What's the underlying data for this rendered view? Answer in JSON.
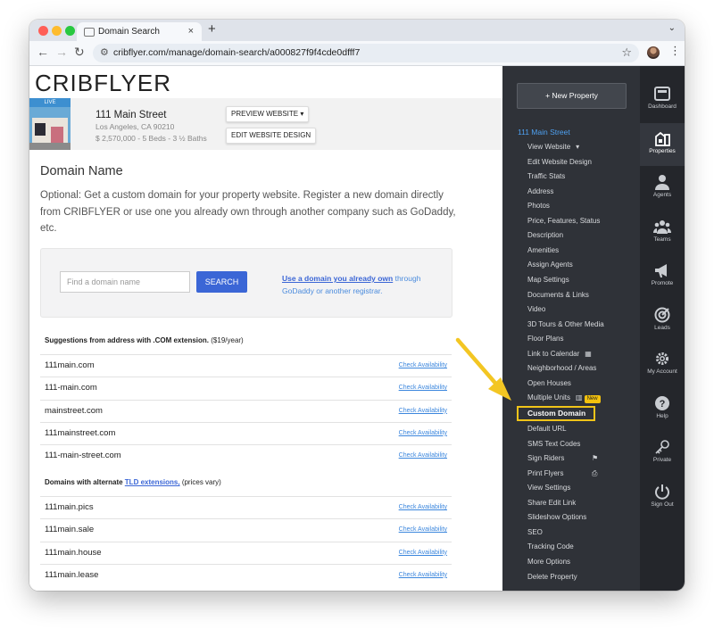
{
  "browser": {
    "tab_title": "Domain Search",
    "url": "cribflyer.com/manage/domain-search/a000827f9f4cde0dfff7",
    "new_tab": "+",
    "tab_close": "×"
  },
  "logo": "CRIBFLYER",
  "property": {
    "live_badge": "LIVE",
    "address": "111 Main Street",
    "city": "Los Angeles, CA 90210",
    "details": "$ 2,570,000 - 5 Beds - 3 ½ Baths",
    "preview_button": "PREVIEW WEBSITE ▾",
    "edit_button": "EDIT WEBSITE DESIGN"
  },
  "main": {
    "heading": "Domain Name",
    "intro": "Optional: Get a custom domain for your property website. Register a new domain directly from CRIBFLYER or use one you already own through another company such as GoDaddy, etc.",
    "search_placeholder": "Find a domain name",
    "search_button": "SEARCH",
    "own_link": "Use a domain you already own",
    "own_text": " through GoDaddy or another registrar.",
    "suggest_heading": "Suggestions from address with .COM extension.",
    "suggest_price": " ($19/year)",
    "com_domains": [
      "111main.com",
      "111-main.com",
      "mainstreet.com",
      "111mainstreet.com",
      "111-main-street.com"
    ],
    "alt_heading_pre": "Domains with alternate ",
    "alt_heading_link": "TLD extensions,",
    "alt_heading_post": " (prices vary)",
    "alt_domains": [
      "111main.pics",
      "111main.sale",
      "111main.house",
      "111main.lease"
    ],
    "check_label": "Check Availability"
  },
  "sidemenu": {
    "new_property": "+ New Property",
    "property_title": "111 Main Street",
    "items": [
      "View Website",
      "Edit Website Design",
      "Traffic Stats",
      "Address",
      "Photos",
      "Price, Features, Status",
      "Description",
      "Amenities",
      "Assign Agents",
      "Map Settings",
      "Documents & Links",
      "Video",
      "3D Tours & Other Media",
      "Floor Plans",
      "Link to Calendar",
      "Neighborhood / Areas",
      "Open Houses",
      "Multiple Units"
    ],
    "new_badge": "New",
    "active_item": "Custom Domain",
    "items_after": [
      "Default URL",
      "SMS Text Codes",
      "Sign Riders",
      "Print Flyers",
      "View Settings",
      "Share Edit Link",
      "Slideshow Options",
      "SEO",
      "Tracking Code",
      "More Options",
      "Delete Property"
    ]
  },
  "rail": [
    {
      "label": "Dashboard",
      "icon": "dashboard-icon"
    },
    {
      "label": "Properties",
      "icon": "properties-icon"
    },
    {
      "label": "Agents",
      "icon": "agent-icon"
    },
    {
      "label": "Teams",
      "icon": "teams-icon"
    },
    {
      "label": "Promote",
      "icon": "megaphone-icon"
    },
    {
      "label": "Leads",
      "icon": "target-icon"
    },
    {
      "label": "My Account",
      "icon": "gear-icon"
    },
    {
      "label": "Help",
      "icon": "help-icon"
    },
    {
      "label": "Private",
      "icon": "key-icon"
    },
    {
      "label": "Sign Out",
      "icon": "power-icon"
    }
  ],
  "colors": {
    "accent": "#3b66d6",
    "menu_bg": "#2f3238",
    "rail_bg": "#24262b",
    "highlight": "#f0c419"
  }
}
